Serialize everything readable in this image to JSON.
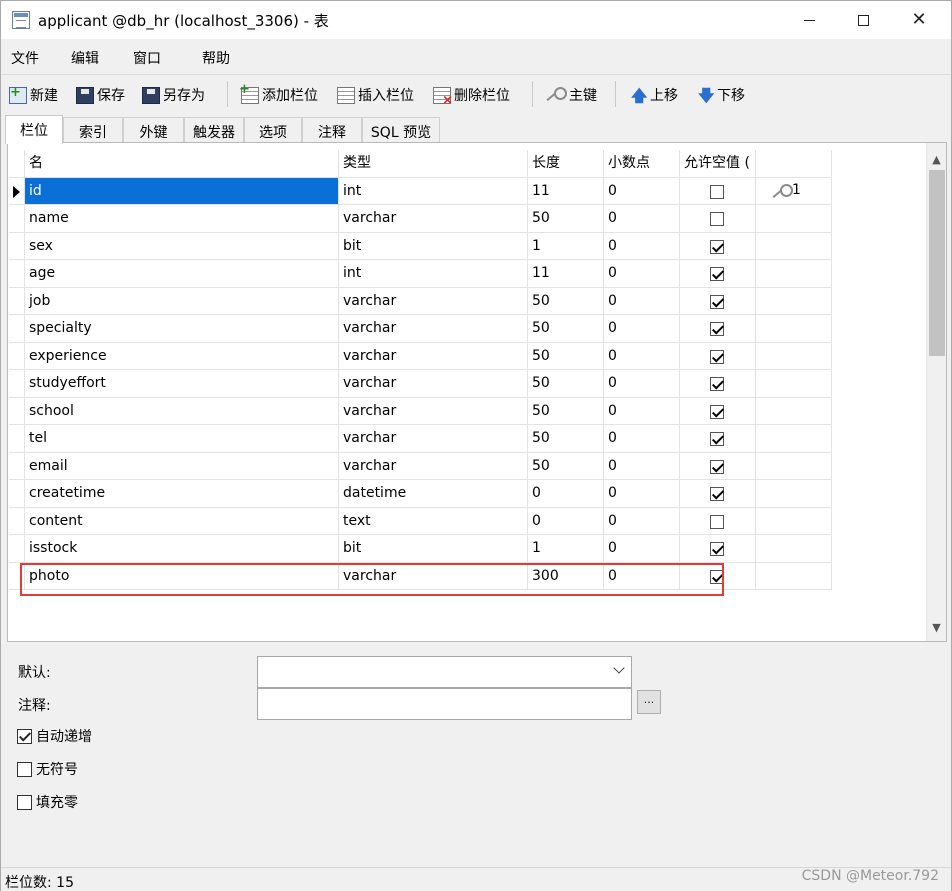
{
  "window": {
    "title": "applicant @db_hr (localhost_3306) - 表",
    "minimize": "–",
    "maximize": "□",
    "close": "✕"
  },
  "menu": [
    "文件",
    "编辑",
    "窗口",
    "帮助"
  ],
  "toolbar": {
    "new": "新建",
    "save": "保存",
    "save_as": "另存为",
    "add_column": "添加栏位",
    "insert_column": "插入栏位",
    "delete_column": "删除栏位",
    "primary_key": "主键",
    "move_up": "上移",
    "move_down": "下移"
  },
  "tabs": [
    "栏位",
    "索引",
    "外键",
    "触发器",
    "选项",
    "注释",
    "SQL 预览"
  ],
  "active_tab": "栏位",
  "grid": {
    "headers": [
      "名",
      "类型",
      "长度",
      "小数点",
      "允许空值 ("
    ],
    "rows": [
      {
        "name": "id",
        "type": "int",
        "length": "11",
        "decimals": "0",
        "nullable": false,
        "key": "1"
      },
      {
        "name": "name",
        "type": "varchar",
        "length": "50",
        "decimals": "0",
        "nullable": false,
        "key": ""
      },
      {
        "name": "sex",
        "type": "bit",
        "length": "1",
        "decimals": "0",
        "nullable": true,
        "key": ""
      },
      {
        "name": "age",
        "type": "int",
        "length": "11",
        "decimals": "0",
        "nullable": true,
        "key": ""
      },
      {
        "name": "job",
        "type": "varchar",
        "length": "50",
        "decimals": "0",
        "nullable": true,
        "key": ""
      },
      {
        "name": "specialty",
        "type": "varchar",
        "length": "50",
        "decimals": "0",
        "nullable": true,
        "key": ""
      },
      {
        "name": "experience",
        "type": "varchar",
        "length": "50",
        "decimals": "0",
        "nullable": true,
        "key": ""
      },
      {
        "name": "studyeffort",
        "type": "varchar",
        "length": "50",
        "decimals": "0",
        "nullable": true,
        "key": ""
      },
      {
        "name": "school",
        "type": "varchar",
        "length": "50",
        "decimals": "0",
        "nullable": true,
        "key": ""
      },
      {
        "name": "tel",
        "type": "varchar",
        "length": "50",
        "decimals": "0",
        "nullable": true,
        "key": ""
      },
      {
        "name": "email",
        "type": "varchar",
        "length": "50",
        "decimals": "0",
        "nullable": true,
        "key": ""
      },
      {
        "name": "createtime",
        "type": "datetime",
        "length": "0",
        "decimals": "0",
        "nullable": true,
        "key": ""
      },
      {
        "name": "content",
        "type": "text",
        "length": "0",
        "decimals": "0",
        "nullable": false,
        "key": ""
      },
      {
        "name": "isstock",
        "type": "bit",
        "length": "1",
        "decimals": "0",
        "nullable": true,
        "key": ""
      },
      {
        "name": "photo",
        "type": "varchar",
        "length": "300",
        "decimals": "0",
        "nullable": true,
        "key": ""
      }
    ],
    "selected_row": 0,
    "highlighted_row": 14
  },
  "properties": {
    "default_label": "默认:",
    "default_value": "",
    "comment_label": "注释:",
    "comment_value": "",
    "ellipsis": "...",
    "auto_increment": {
      "label": "自动递增",
      "checked": true
    },
    "unsigned": {
      "label": "无符号",
      "checked": false
    },
    "zerofill": {
      "label": "填充零",
      "checked": false
    }
  },
  "status": {
    "text": "栏位数: 15",
    "watermark": "CSDN @Meteor.792"
  },
  "icons": {
    "app": "table-designer-icon",
    "new": "new-table-icon",
    "save": "floppy-disk-icon",
    "save_as": "floppy-disk-icon",
    "add_column": "add-column-icon",
    "insert_column": "insert-column-icon",
    "delete_column": "delete-column-icon",
    "primary_key": "key-icon",
    "move_up": "arrow-up-icon",
    "move_down": "arrow-down-icon"
  },
  "colors": {
    "selection": "#0a6fd6",
    "highlight_box": "#e03c3c",
    "up_down_arrows": "#2a6fd0"
  }
}
